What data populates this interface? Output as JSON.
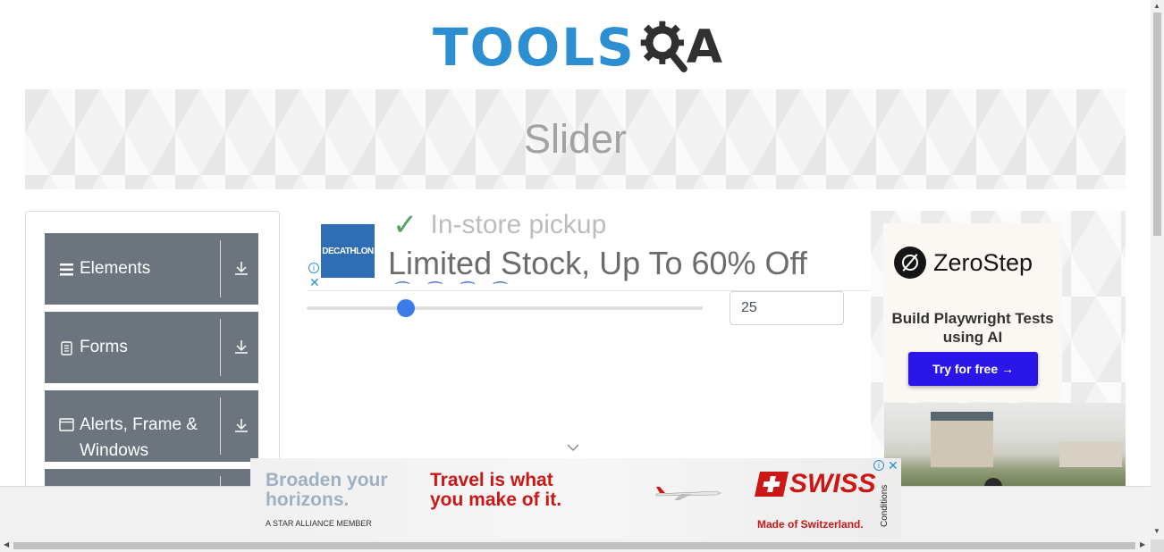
{
  "logo": {
    "part1": "TOOLS",
    "part2": "A"
  },
  "banner": {
    "title": "Slider"
  },
  "sidebar": {
    "groups": [
      {
        "label": "Elements",
        "icon": "hamburger-icon"
      },
      {
        "label": "Forms",
        "icon": "document-icon"
      },
      {
        "label": "Alerts, Frame & Windows",
        "icon": "window-icon"
      }
    ]
  },
  "ad_top": {
    "brand": "DECATHLON",
    "pickup": "In-store pickup",
    "headline": "Limited Stock, Up To 60% Off"
  },
  "slider": {
    "value": "25",
    "min": 0,
    "max": 100,
    "fraction": 0.25
  },
  "right_ad": {
    "brand": "ZeroStep",
    "tagline": "Build Playwright Tests using AI",
    "cta": "Try for free →"
  },
  "bottom_ad": {
    "left_line": "Broaden your horizons.",
    "mid_line": "Travel is what you make of it.",
    "member": "A STAR ALLIANCE MEMBER",
    "brand": "SWISS",
    "tag": "Made of Switzerland.",
    "conditions": "Conditions"
  },
  "colors": {
    "accent": "#2b8fd1",
    "sidebar": "#6c757d",
    "slider": "#3b7ce9",
    "cta": "#2a16e8",
    "swiss": "#cc1717"
  }
}
